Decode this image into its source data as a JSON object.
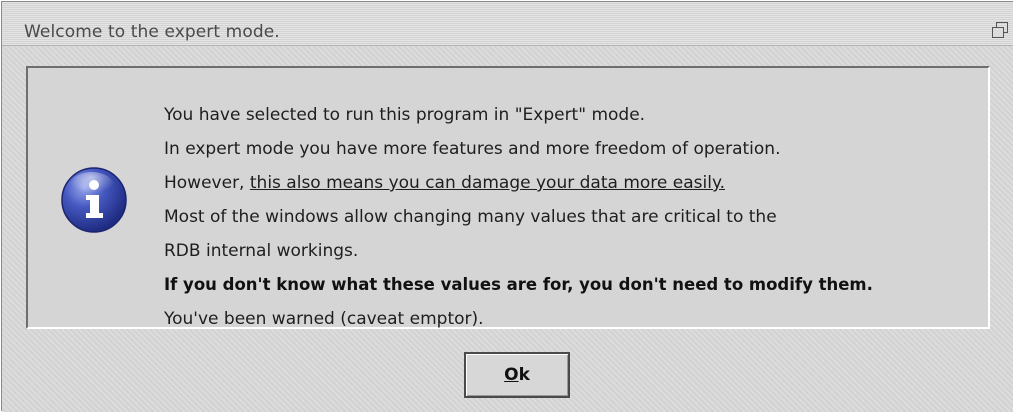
{
  "window": {
    "title": "Welcome to the expert mode."
  },
  "message": {
    "line1": "You have selected to run this program in \"Expert\" mode.",
    "line2": "In expert mode you have more features and more freedom of operation.",
    "line3_prefix": "However, ",
    "line3_underlined": "this also means you can damage your data more easily.",
    "line4": "Most of the windows allow changing many values that are critical to the",
    "line5": "RDB internal workings.",
    "line6_bold": "If you don't know what these values are for, you don't need to modify them.",
    "line7": "You've been warned (caveat emptor)."
  },
  "icons": {
    "info": "info-icon",
    "restore": "restore-window-icon"
  },
  "buttons": {
    "ok_mnemonic": "O",
    "ok_rest": "k"
  },
  "colors": {
    "info_icon_blue": "#2e3f9c",
    "dialog_gray": "#d6d6d6"
  }
}
